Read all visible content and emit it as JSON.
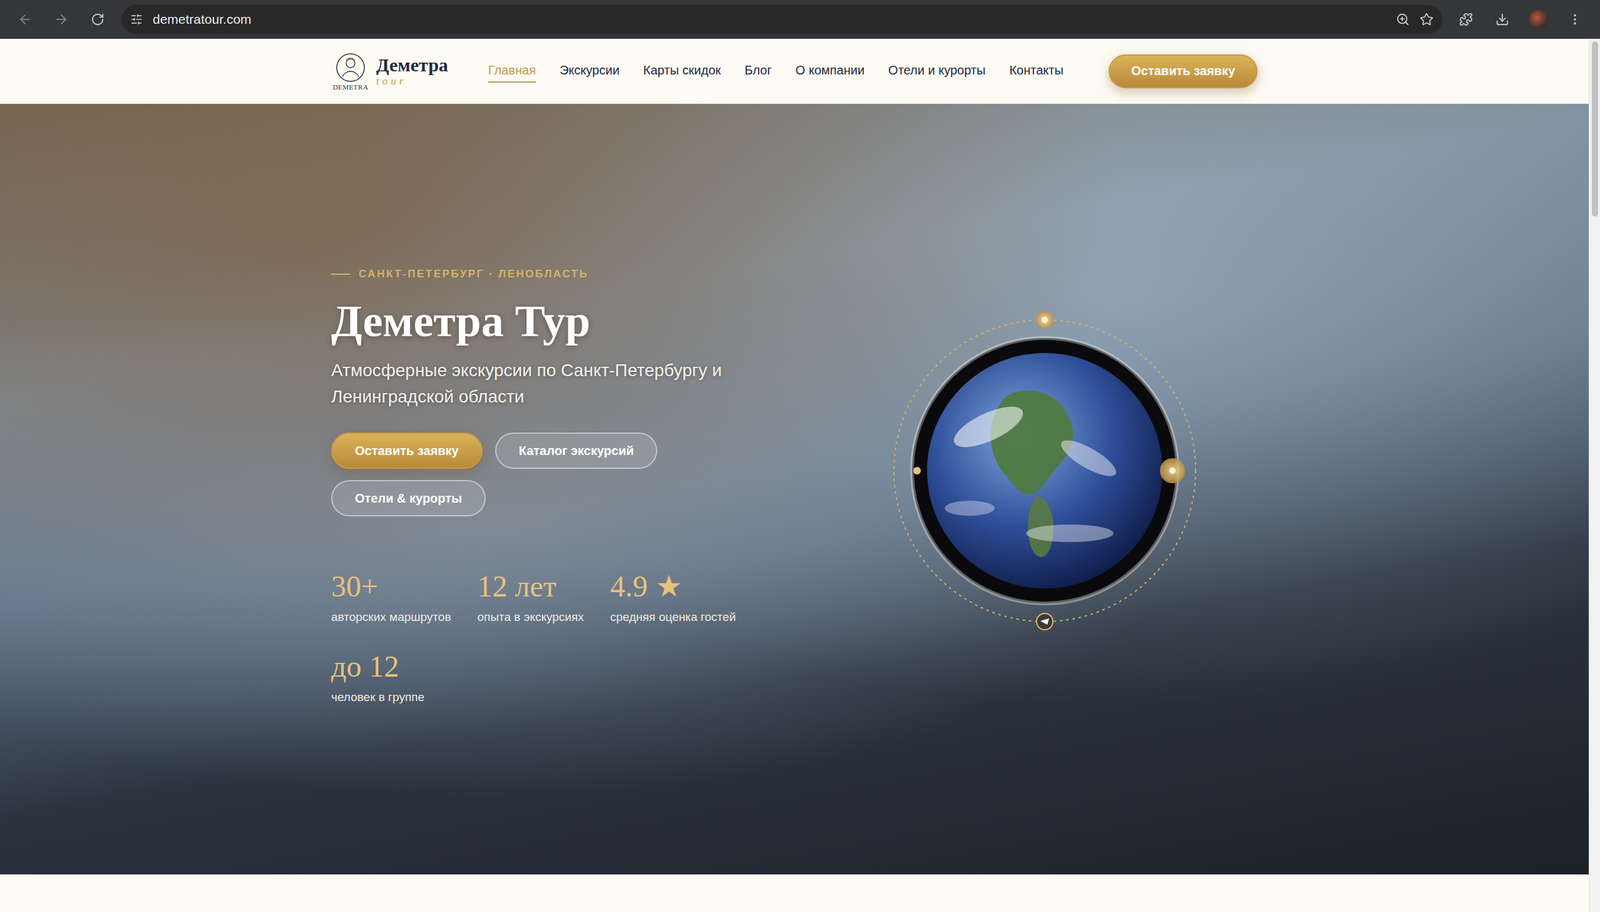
{
  "browser": {
    "url": "demetratour.com"
  },
  "header": {
    "logo": {
      "emblem": "DEMETRA",
      "name": "Деметра",
      "tagline": "tour"
    },
    "nav": [
      {
        "label": "Главная",
        "selected": true
      },
      {
        "label": "Экскурсии",
        "selected": false
      },
      {
        "label": "Карты скидок",
        "selected": false
      },
      {
        "label": "Блог",
        "selected": false
      },
      {
        "label": "О компании",
        "selected": false
      },
      {
        "label": "Отели и курорты",
        "selected": false
      },
      {
        "label": "Контакты",
        "selected": false
      }
    ],
    "cta": "Оставить заявку"
  },
  "hero": {
    "eyebrow": "САНКТ-ПЕТЕРБУРГ · ЛЕНОБЛАСТЬ",
    "title": "Деметра Тур",
    "subtitle": "Атмосферные экскурсии по Санкт-Петербургу и Ленинградской области",
    "buttons": [
      {
        "label": "Оставить заявку",
        "kind": "primary"
      },
      {
        "label": "Каталог экскурсий",
        "kind": "secondary"
      },
      {
        "label": "Отели & курорты",
        "kind": "secondary"
      }
    ],
    "stats": [
      {
        "value": "30+",
        "label": "авторских маршрутов"
      },
      {
        "value": "12 лет",
        "label": "опыта в экскурсиях"
      },
      {
        "value": "4.9 ★",
        "label": "средняя оценка гостей"
      },
      {
        "value": "до 12",
        "label": "человек в группе"
      }
    ]
  }
}
